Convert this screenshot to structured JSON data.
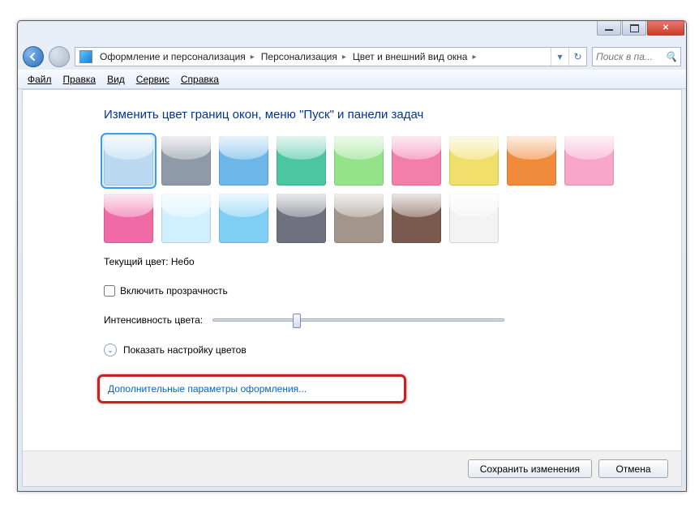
{
  "breadcrumbs": [
    "Оформление и персонализация",
    "Персонализация",
    "Цвет и внешний вид окна"
  ],
  "search": {
    "placeholder": "Поиск в па..."
  },
  "menus": {
    "file": "Файл",
    "edit": "Правка",
    "view": "Вид",
    "tools": "Сервис",
    "help": "Справка"
  },
  "heading": "Изменить цвет границ окон, меню \"Пуск\" и панели задач",
  "colors": [
    "#bcd9f2",
    "#8e9aa8",
    "#6db7e8",
    "#4cc6a0",
    "#94e28a",
    "#f37fa9",
    "#f1df6c",
    "#f18b3c",
    "#f7a5c9",
    "#f06aa6",
    "#d0f0ff",
    "#7fcff5",
    "#6f717f",
    "#a3958c",
    "#7a5a4f",
    "#f3f3f3"
  ],
  "selected_color_index": 0,
  "current_color": {
    "label": "Текущий цвет:",
    "name": "Небо"
  },
  "transparency_label": "Включить прозрачность",
  "intensity_label": "Интенсивность цвета:",
  "show_mixer_label": "Показать настройку цветов",
  "advanced_link": "Дополнительные параметры оформления...",
  "buttons": {
    "save": "Сохранить изменения",
    "cancel": "Отмена"
  }
}
